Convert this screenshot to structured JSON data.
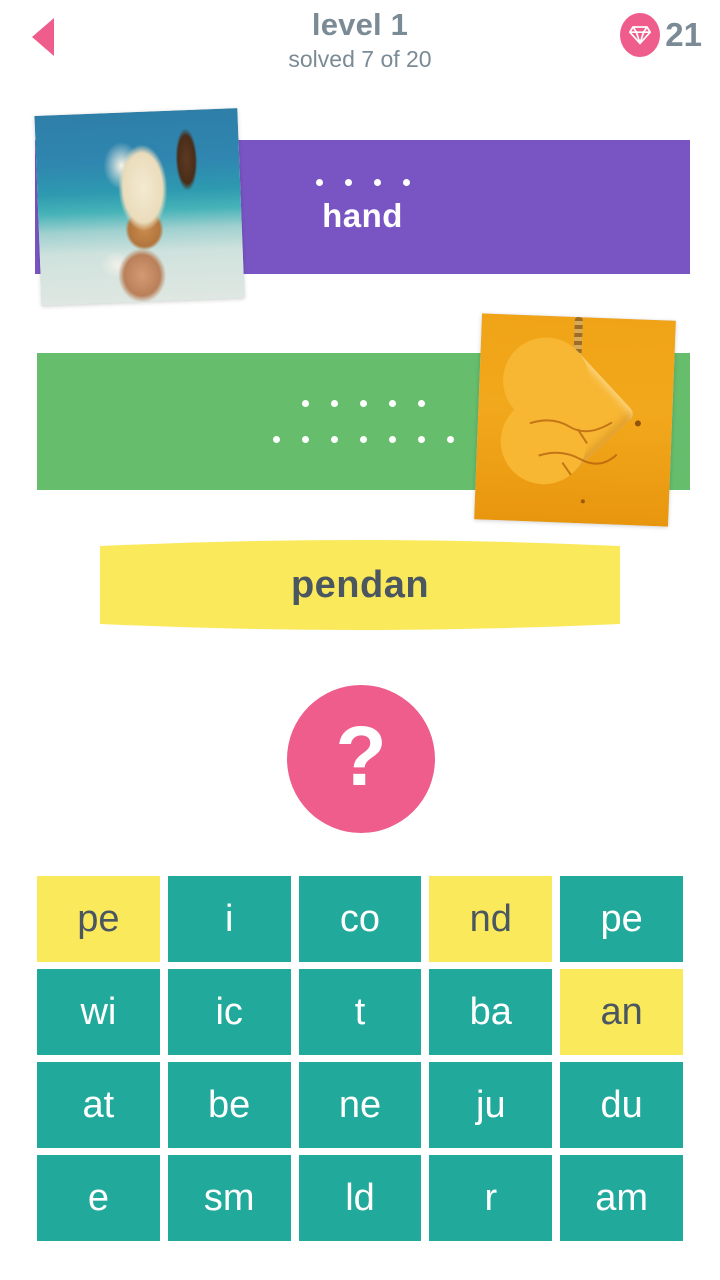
{
  "header": {
    "back_icon": "back-triangle-icon",
    "title": "level 1",
    "subtitle": "solved 7 of 20",
    "gem_icon": "diamond-icon",
    "gem_count": "21",
    "accent_pink": "#ee5d8c",
    "text_gray": "#7b8b96"
  },
  "puzzles": [
    {
      "card_color": "#7955c4",
      "photo": "ice-cream-cone-photo",
      "dot_lines": [
        4
      ],
      "word": "hand"
    },
    {
      "card_color": "#66bd6c",
      "photo": "amber-heart-pendant-photo",
      "dot_lines": [
        5,
        7
      ],
      "word": ""
    }
  ],
  "answer": {
    "text": "pendan",
    "color": "#fbe95c",
    "text_color": "#4a5660"
  },
  "hint": {
    "icon": "question-mark-icon",
    "label": "?",
    "color": "#ee5d8c"
  },
  "tiles": {
    "teal": "#21a99b",
    "yellow": "#fbe95c",
    "rows": [
      [
        {
          "label": "pe",
          "state": "selected"
        },
        {
          "label": "i",
          "state": "available"
        },
        {
          "label": "co",
          "state": "available"
        },
        {
          "label": "nd",
          "state": "selected"
        },
        {
          "label": "pe",
          "state": "available"
        }
      ],
      [
        {
          "label": "wi",
          "state": "available"
        },
        {
          "label": "ic",
          "state": "available"
        },
        {
          "label": "t",
          "state": "available"
        },
        {
          "label": "ba",
          "state": "available"
        },
        {
          "label": "an",
          "state": "selected"
        }
      ],
      [
        {
          "label": "at",
          "state": "available"
        },
        {
          "label": "be",
          "state": "available"
        },
        {
          "label": "ne",
          "state": "available"
        },
        {
          "label": "ju",
          "state": "available"
        },
        {
          "label": "du",
          "state": "available"
        }
      ],
      [
        {
          "label": "e",
          "state": "available"
        },
        {
          "label": "sm",
          "state": "available"
        },
        {
          "label": "ld",
          "state": "available"
        },
        {
          "label": "r",
          "state": "available"
        },
        {
          "label": "am",
          "state": "available"
        }
      ]
    ]
  }
}
